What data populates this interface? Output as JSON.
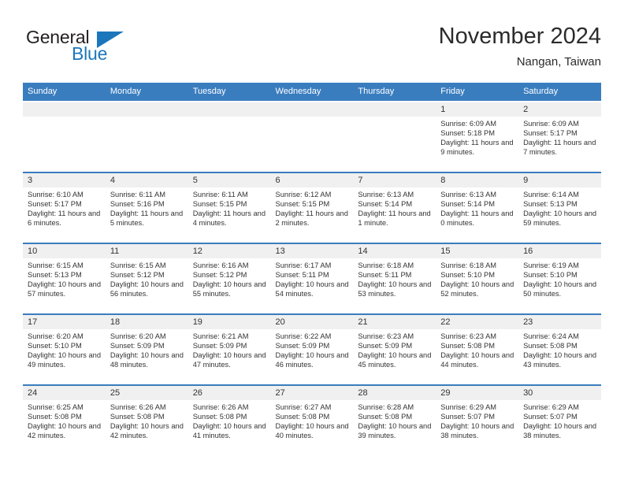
{
  "brand": {
    "name_part1": "General",
    "name_part2": "Blue",
    "logo_icon": "triangle-icon"
  },
  "header": {
    "title": "November 2024",
    "subtitle": "Nangan, Taiwan"
  },
  "weekday_headers": [
    "Sunday",
    "Monday",
    "Tuesday",
    "Wednesday",
    "Thursday",
    "Friday",
    "Saturday"
  ],
  "colors": {
    "header_blue": "#3a7dbf",
    "brand_blue": "#1c76bc",
    "band_gray": "#f0f0f0",
    "text": "#333333"
  },
  "weeks": [
    [
      {
        "day": "",
        "sunrise": "",
        "sunset": "",
        "daylight": "",
        "empty": true
      },
      {
        "day": "",
        "sunrise": "",
        "sunset": "",
        "daylight": "",
        "empty": true
      },
      {
        "day": "",
        "sunrise": "",
        "sunset": "",
        "daylight": "",
        "empty": true
      },
      {
        "day": "",
        "sunrise": "",
        "sunset": "",
        "daylight": "",
        "empty": true
      },
      {
        "day": "",
        "sunrise": "",
        "sunset": "",
        "daylight": "",
        "empty": true
      },
      {
        "day": "1",
        "sunrise": "Sunrise: 6:09 AM",
        "sunset": "Sunset: 5:18 PM",
        "daylight": "Daylight: 11 hours and 9 minutes.",
        "empty": false
      },
      {
        "day": "2",
        "sunrise": "Sunrise: 6:09 AM",
        "sunset": "Sunset: 5:17 PM",
        "daylight": "Daylight: 11 hours and 7 minutes.",
        "empty": false
      }
    ],
    [
      {
        "day": "3",
        "sunrise": "Sunrise: 6:10 AM",
        "sunset": "Sunset: 5:17 PM",
        "daylight": "Daylight: 11 hours and 6 minutes.",
        "empty": false
      },
      {
        "day": "4",
        "sunrise": "Sunrise: 6:11 AM",
        "sunset": "Sunset: 5:16 PM",
        "daylight": "Daylight: 11 hours and 5 minutes.",
        "empty": false
      },
      {
        "day": "5",
        "sunrise": "Sunrise: 6:11 AM",
        "sunset": "Sunset: 5:15 PM",
        "daylight": "Daylight: 11 hours and 4 minutes.",
        "empty": false
      },
      {
        "day": "6",
        "sunrise": "Sunrise: 6:12 AM",
        "sunset": "Sunset: 5:15 PM",
        "daylight": "Daylight: 11 hours and 2 minutes.",
        "empty": false
      },
      {
        "day": "7",
        "sunrise": "Sunrise: 6:13 AM",
        "sunset": "Sunset: 5:14 PM",
        "daylight": "Daylight: 11 hours and 1 minute.",
        "empty": false
      },
      {
        "day": "8",
        "sunrise": "Sunrise: 6:13 AM",
        "sunset": "Sunset: 5:14 PM",
        "daylight": "Daylight: 11 hours and 0 minutes.",
        "empty": false
      },
      {
        "day": "9",
        "sunrise": "Sunrise: 6:14 AM",
        "sunset": "Sunset: 5:13 PM",
        "daylight": "Daylight: 10 hours and 59 minutes.",
        "empty": false
      }
    ],
    [
      {
        "day": "10",
        "sunrise": "Sunrise: 6:15 AM",
        "sunset": "Sunset: 5:13 PM",
        "daylight": "Daylight: 10 hours and 57 minutes.",
        "empty": false
      },
      {
        "day": "11",
        "sunrise": "Sunrise: 6:15 AM",
        "sunset": "Sunset: 5:12 PM",
        "daylight": "Daylight: 10 hours and 56 minutes.",
        "empty": false
      },
      {
        "day": "12",
        "sunrise": "Sunrise: 6:16 AM",
        "sunset": "Sunset: 5:12 PM",
        "daylight": "Daylight: 10 hours and 55 minutes.",
        "empty": false
      },
      {
        "day": "13",
        "sunrise": "Sunrise: 6:17 AM",
        "sunset": "Sunset: 5:11 PM",
        "daylight": "Daylight: 10 hours and 54 minutes.",
        "empty": false
      },
      {
        "day": "14",
        "sunrise": "Sunrise: 6:18 AM",
        "sunset": "Sunset: 5:11 PM",
        "daylight": "Daylight: 10 hours and 53 minutes.",
        "empty": false
      },
      {
        "day": "15",
        "sunrise": "Sunrise: 6:18 AM",
        "sunset": "Sunset: 5:10 PM",
        "daylight": "Daylight: 10 hours and 52 minutes.",
        "empty": false
      },
      {
        "day": "16",
        "sunrise": "Sunrise: 6:19 AM",
        "sunset": "Sunset: 5:10 PM",
        "daylight": "Daylight: 10 hours and 50 minutes.",
        "empty": false
      }
    ],
    [
      {
        "day": "17",
        "sunrise": "Sunrise: 6:20 AM",
        "sunset": "Sunset: 5:10 PM",
        "daylight": "Daylight: 10 hours and 49 minutes.",
        "empty": false
      },
      {
        "day": "18",
        "sunrise": "Sunrise: 6:20 AM",
        "sunset": "Sunset: 5:09 PM",
        "daylight": "Daylight: 10 hours and 48 minutes.",
        "empty": false
      },
      {
        "day": "19",
        "sunrise": "Sunrise: 6:21 AM",
        "sunset": "Sunset: 5:09 PM",
        "daylight": "Daylight: 10 hours and 47 minutes.",
        "empty": false
      },
      {
        "day": "20",
        "sunrise": "Sunrise: 6:22 AM",
        "sunset": "Sunset: 5:09 PM",
        "daylight": "Daylight: 10 hours and 46 minutes.",
        "empty": false
      },
      {
        "day": "21",
        "sunrise": "Sunrise: 6:23 AM",
        "sunset": "Sunset: 5:09 PM",
        "daylight": "Daylight: 10 hours and 45 minutes.",
        "empty": false
      },
      {
        "day": "22",
        "sunrise": "Sunrise: 6:23 AM",
        "sunset": "Sunset: 5:08 PM",
        "daylight": "Daylight: 10 hours and 44 minutes.",
        "empty": false
      },
      {
        "day": "23",
        "sunrise": "Sunrise: 6:24 AM",
        "sunset": "Sunset: 5:08 PM",
        "daylight": "Daylight: 10 hours and 43 minutes.",
        "empty": false
      }
    ],
    [
      {
        "day": "24",
        "sunrise": "Sunrise: 6:25 AM",
        "sunset": "Sunset: 5:08 PM",
        "daylight": "Daylight: 10 hours and 42 minutes.",
        "empty": false
      },
      {
        "day": "25",
        "sunrise": "Sunrise: 6:26 AM",
        "sunset": "Sunset: 5:08 PM",
        "daylight": "Daylight: 10 hours and 42 minutes.",
        "empty": false
      },
      {
        "day": "26",
        "sunrise": "Sunrise: 6:26 AM",
        "sunset": "Sunset: 5:08 PM",
        "daylight": "Daylight: 10 hours and 41 minutes.",
        "empty": false
      },
      {
        "day": "27",
        "sunrise": "Sunrise: 6:27 AM",
        "sunset": "Sunset: 5:08 PM",
        "daylight": "Daylight: 10 hours and 40 minutes.",
        "empty": false
      },
      {
        "day": "28",
        "sunrise": "Sunrise: 6:28 AM",
        "sunset": "Sunset: 5:08 PM",
        "daylight": "Daylight: 10 hours and 39 minutes.",
        "empty": false
      },
      {
        "day": "29",
        "sunrise": "Sunrise: 6:29 AM",
        "sunset": "Sunset: 5:07 PM",
        "daylight": "Daylight: 10 hours and 38 minutes.",
        "empty": false
      },
      {
        "day": "30",
        "sunrise": "Sunrise: 6:29 AM",
        "sunset": "Sunset: 5:07 PM",
        "daylight": "Daylight: 10 hours and 38 minutes.",
        "empty": false
      }
    ]
  ]
}
